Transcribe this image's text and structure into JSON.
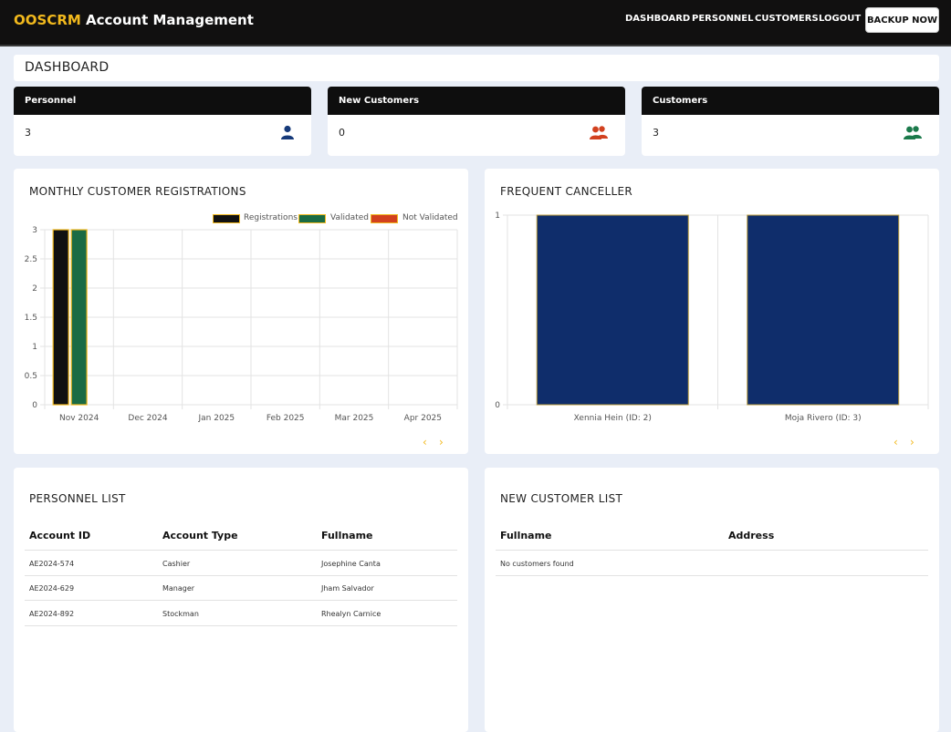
{
  "nav": {
    "brand_accent": "OOSCRM",
    "brand_rest": "Account Management",
    "links": [
      "DASHBOARD",
      "PERSONNEL",
      "CUSTOMERS",
      "LOGOUT"
    ],
    "backup_label": "BACKUP NOW"
  },
  "page": {
    "title": "DASHBOARD"
  },
  "stats": [
    {
      "label": "Personnel",
      "value": "3",
      "icon": "user-icon",
      "color": "#163a7a"
    },
    {
      "label": "New Customers",
      "value": "0",
      "icon": "users-icon",
      "color": "#d2411f"
    },
    {
      "label": "Customers",
      "value": "3",
      "icon": "users-icon",
      "color": "#1b7a4b"
    }
  ],
  "monthly": {
    "title": "MONTHLY CUSTOMER REGISTRATIONS",
    "legend": [
      "Registrations",
      "Validated",
      "Not Validated"
    ]
  },
  "frequent": {
    "title": "FREQUENT CANCELLER"
  },
  "chart_data": [
    {
      "type": "bar",
      "title": "MONTHLY CUSTOMER REGISTRATIONS",
      "categories": [
        "Nov 2024",
        "Dec 2024",
        "Jan 2025",
        "Feb 2025",
        "Mar 2025",
        "Apr 2025"
      ],
      "series": [
        {
          "name": "Registrations",
          "values": [
            3,
            0,
            0,
            0,
            0,
            0
          ],
          "color": "#111111"
        },
        {
          "name": "Validated",
          "values": [
            3,
            0,
            0,
            0,
            0,
            0
          ],
          "color": "#1a6b44"
        },
        {
          "name": "Not Validated",
          "values": [
            0,
            0,
            0,
            0,
            0,
            0
          ],
          "color": "#d2411f"
        }
      ],
      "ylim": [
        0,
        3
      ],
      "yticks": [
        "0",
        "0.5",
        "1",
        "1.5",
        "2",
        "2.5",
        "3"
      ],
      "grid": true,
      "legend_position": "top-right"
    },
    {
      "type": "bar",
      "title": "FREQUENT CANCELLER",
      "categories": [
        "Xennia Hein (ID: 2)",
        "Moja Rivero (ID: 3)"
      ],
      "values": [
        1,
        1
      ],
      "color": "#0f2d6b",
      "ylim": [
        0,
        1
      ],
      "yticks": [
        "0",
        "1"
      ],
      "grid": true
    }
  ],
  "personnel": {
    "title": "PERSONNEL LIST",
    "headers": [
      "Account ID",
      "Account Type",
      "Fullname"
    ],
    "rows": [
      [
        "AE2024-574",
        "Cashier",
        "Josephine Canta"
      ],
      [
        "AE2024-629",
        "Manager",
        "Jham Salvador"
      ],
      [
        "AE2024-892",
        "Stockman",
        "Rhealyn Carnice"
      ]
    ]
  },
  "new_customers": {
    "title": "NEW CUSTOMER LIST",
    "headers": [
      "Fullname",
      "Address"
    ],
    "empty_text": "No customers found"
  },
  "pager": {
    "prev": "‹",
    "next": "›"
  }
}
